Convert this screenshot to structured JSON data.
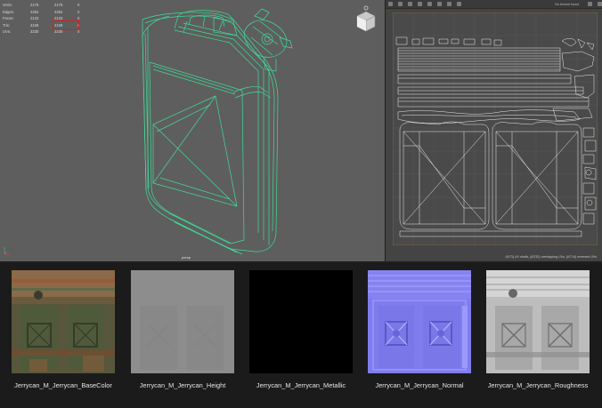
{
  "hud": {
    "rows": [
      {
        "label": "Verts:",
        "v1": "2176",
        "v2": "2176",
        "v3": "0"
      },
      {
        "label": "Edges:",
        "v1": "4252",
        "v2": "4252",
        "v3": "0"
      },
      {
        "label": "Faces:",
        "v1": "2133",
        "v2": "2133",
        "v3": "0"
      },
      {
        "label": "Tris:",
        "v1": "4108",
        "v2": "4108",
        "v3": "0"
      },
      {
        "label": "UVs:",
        "v1": "3230",
        "v2": "3230",
        "v3": "0"
      }
    ],
    "highlighted_value": "4108",
    "highlight_color": "#d42020"
  },
  "viewport": {
    "camera_label": "persp",
    "background_color": "#5e5e5e",
    "wireframe_color": "#3fdb9a",
    "viewcube_icon": "viewcube-icon",
    "axis_icon": "axis-gizmo-icon"
  },
  "uv_editor": {
    "toolbar_text": "No texture found",
    "status_text": "(9/73) UV shells, (0/232) overlapping UVs, (0/714) reversed UVs",
    "background_color": "#444444"
  },
  "textures": [
    {
      "label": "Jerrycan_M_Jerrycan_BaseColor"
    },
    {
      "label": "Jerrycan_M_Jerrycan_Height"
    },
    {
      "label": "Jerrycan_M_Jerrycan_Metallic"
    },
    {
      "label": "Jerrycan_M_Jerrycan_Normal"
    },
    {
      "label": "Jerrycan_M_Jerrycan_Roughness"
    }
  ]
}
